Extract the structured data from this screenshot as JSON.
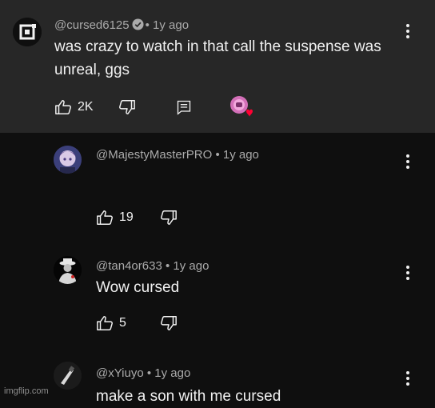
{
  "comments": [
    {
      "handle": "@cursed6125",
      "time": "• 1y ago",
      "verified": true,
      "text": "was crazy to watch in that call the suspense was unreal, ggs",
      "likes": "2K"
    },
    {
      "handle": "@MajestyMasterPRO",
      "time": "• 1y ago",
      "text": "",
      "likes": "19"
    },
    {
      "handle": "@tan4or633",
      "time": "• 1y ago",
      "text": "Wow cursed",
      "likes": "5"
    },
    {
      "handle": "@xYiuyo",
      "time": "• 1y ago",
      "text": "make a son with me cursed"
    }
  ],
  "watermark": "imgflip.com",
  "colors": {
    "highlight_bg": "#272727",
    "page_bg": "#0f0f0f",
    "text": "#f1f1f1",
    "meta": "#aaaaaa",
    "heart": "#ff0033"
  },
  "icons": [
    "thumbs-up-icon",
    "thumbs-down-icon",
    "reply-icon",
    "creator-heart-icon",
    "more-vertical-icon",
    "verified-check-icon"
  ]
}
